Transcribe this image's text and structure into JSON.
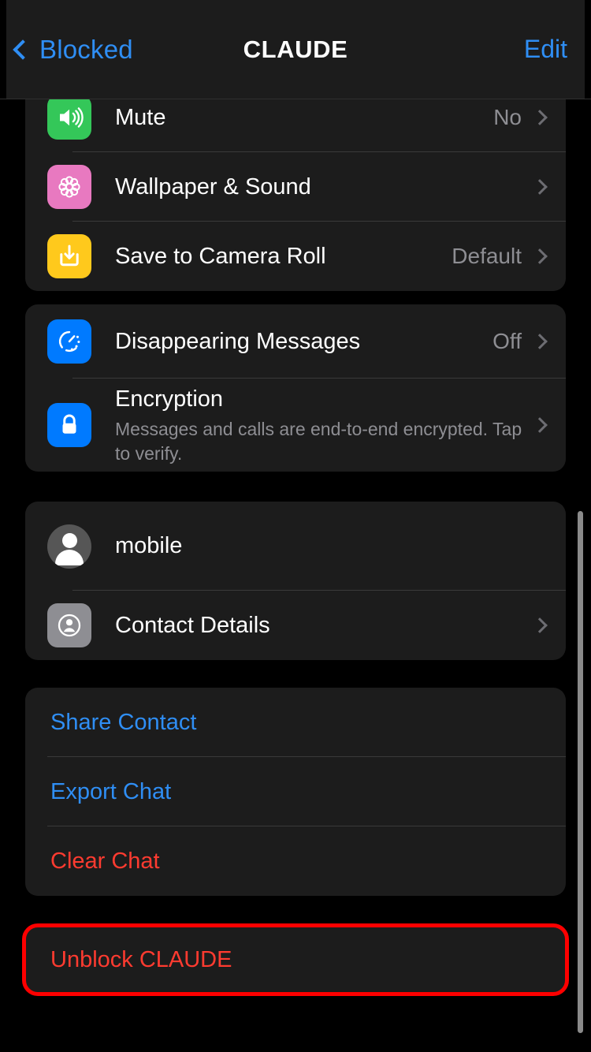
{
  "nav": {
    "back_label": "Blocked",
    "title": "CLAUDE",
    "edit_label": "Edit",
    "back_icon": "chevron-left-icon"
  },
  "colors": {
    "page_bg": "#000000",
    "card_bg": "#1c1c1c",
    "accent_blue": "#2f8ef4",
    "destructive_red": "#ff3b30",
    "annotation_red": "#ff0000",
    "secondary_text": "#8e8e93",
    "icon_green": "#34c759",
    "icon_pink": "#e879c0",
    "icon_yellow": "#ffc91c",
    "icon_blue": "#007aff",
    "icon_gray": "#8e8e93"
  },
  "groups": {
    "general": {
      "rows": [
        {
          "label": "Mute",
          "value": "No",
          "icon": "speaker-mute-icon",
          "icon_color": "#34c759",
          "has_chevron": true
        },
        {
          "label": "Wallpaper & Sound",
          "value": "",
          "icon": "flower-wallpaper-icon",
          "icon_color": "#e879c0",
          "has_chevron": true
        },
        {
          "label": "Save to Camera Roll",
          "value": "Default",
          "icon": "download-tray-icon",
          "icon_color": "#ffc91c",
          "has_chevron": true
        }
      ]
    },
    "privacy": {
      "rows": [
        {
          "label": "Disappearing Messages",
          "value": "Off",
          "icon": "timer-icon",
          "icon_color": "#007aff",
          "has_chevron": true
        },
        {
          "label": "Encryption",
          "subtitle": "Messages and calls are end-to-end encrypted. Tap to verify.",
          "value": "",
          "icon": "lock-icon",
          "icon_color": "#007aff",
          "has_chevron": true
        }
      ]
    },
    "contact": {
      "rows": [
        {
          "label": "mobile",
          "value": "",
          "icon": "avatar-icon",
          "has_chevron": false
        },
        {
          "label": "Contact Details",
          "value": "",
          "icon": "contact-card-icon",
          "icon_color": "#8e8e93",
          "has_chevron": true
        }
      ]
    },
    "actions": {
      "rows": [
        {
          "label": "Share Contact",
          "style": "blue"
        },
        {
          "label": "Export Chat",
          "style": "blue"
        },
        {
          "label": "Clear Chat",
          "style": "red"
        }
      ]
    },
    "unblock": {
      "rows": [
        {
          "label": "Unblock CLAUDE",
          "style": "red"
        }
      ]
    }
  }
}
